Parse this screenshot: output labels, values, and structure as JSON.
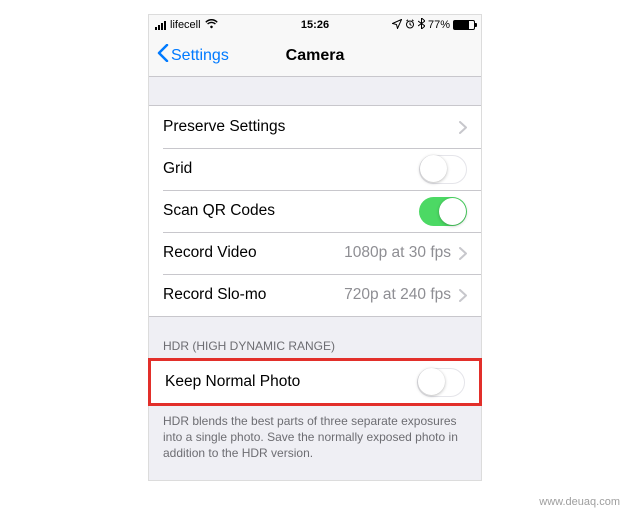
{
  "status": {
    "carrier": "lifecell",
    "time": "15:26",
    "battery_pct": "77%"
  },
  "nav": {
    "back_label": "Settings",
    "title": "Camera"
  },
  "rows": {
    "preserve": {
      "label": "Preserve Settings"
    },
    "grid": {
      "label": "Grid"
    },
    "scan_qr": {
      "label": "Scan QR Codes"
    },
    "record_video": {
      "label": "Record Video",
      "value": "1080p at 30 fps"
    },
    "record_slomo": {
      "label": "Record Slo-mo",
      "value": "720p at 240 fps"
    }
  },
  "hdr": {
    "header": "HDR (HIGH DYNAMIC RANGE)",
    "keep_normal": {
      "label": "Keep Normal Photo"
    },
    "footer": "HDR blends the best parts of three separate exposures into a single photo. Save the normally exposed photo in addition to the HDR version."
  },
  "watermark": "www.deuaq.com"
}
